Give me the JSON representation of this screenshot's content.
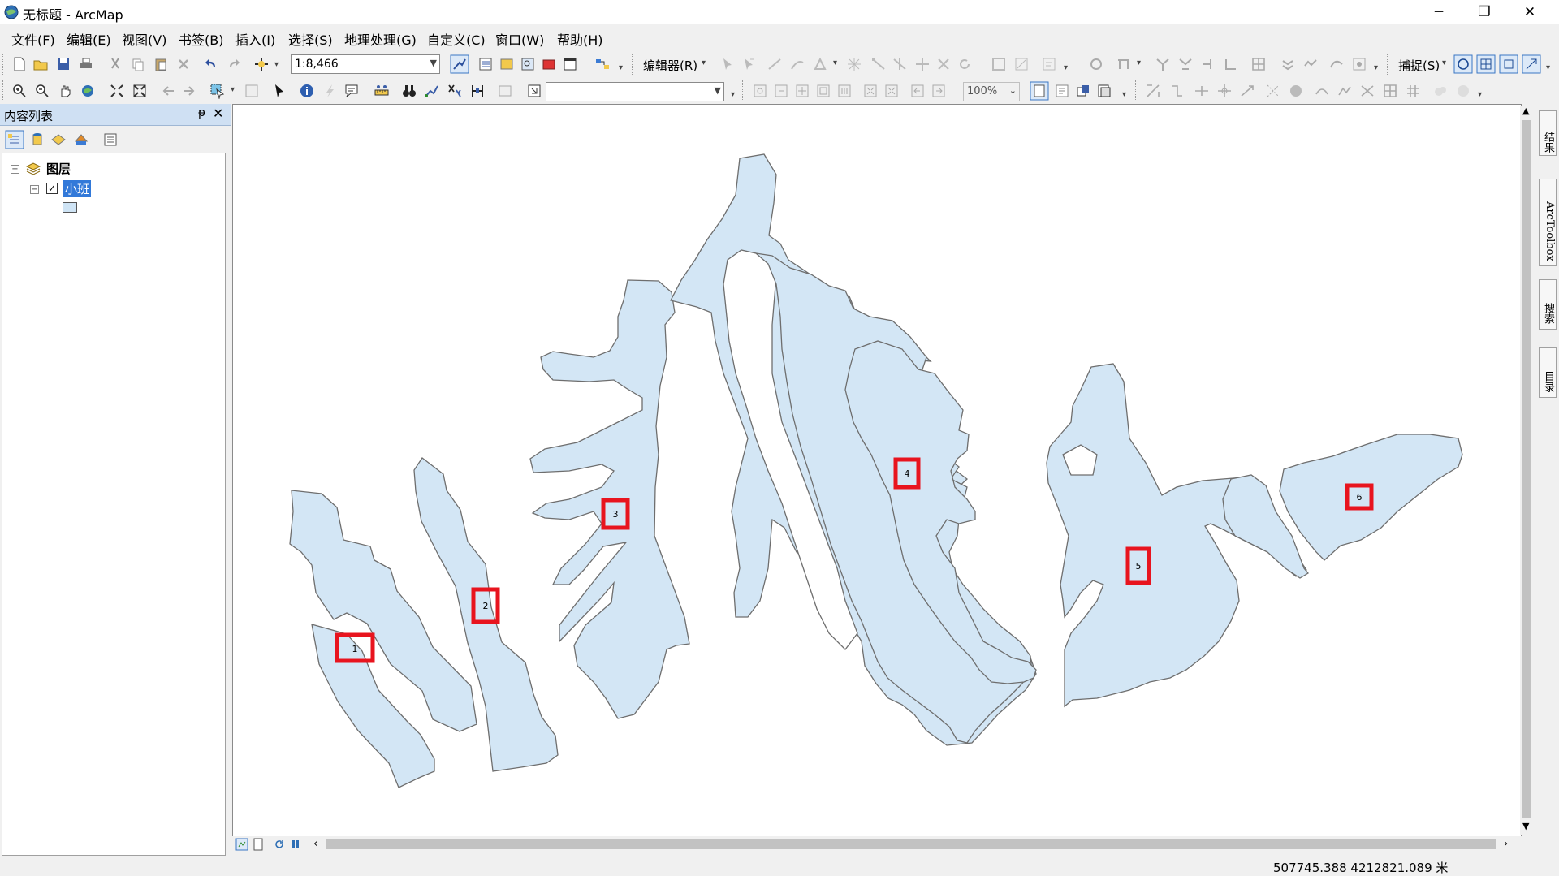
{
  "window": {
    "title": "无标题 - ArcMap",
    "minimize": "─",
    "restore": "❐",
    "close": "✕"
  },
  "menu": [
    "文件(F)",
    "编辑(E)",
    "视图(V)",
    "书签(B)",
    "插入(I)",
    "选择(S)",
    "地理处理(G)",
    "自定义(C)",
    "窗口(W)",
    "帮助(H)"
  ],
  "toolbar": {
    "scale_value": "1:8,466",
    "editor_label": "编辑器(R)",
    "snapping_label": "捕捉(S)",
    "zoom_percent": "100%",
    "layer_combo_value": ""
  },
  "toc": {
    "title": "内容列表",
    "pin": "ᵽ",
    "close": "✕",
    "group_label": "图层",
    "layer_label": "小班",
    "layer_checked": true
  },
  "map": {
    "fill_color": "#d3e6f5",
    "label_box_color": "#e8141e",
    "features": [
      {
        "id": "1",
        "label": "1"
      },
      {
        "id": "2",
        "label": "2"
      },
      {
        "id": "3",
        "label": "3"
      },
      {
        "id": "4",
        "label": "4"
      },
      {
        "id": "5",
        "label": "5"
      },
      {
        "id": "6",
        "label": "6"
      }
    ]
  },
  "right_dock": [
    "结果",
    "ArcToolbox",
    "搜索",
    "目录"
  ],
  "status": {
    "coordinates": "507745.388  4212821.089 米"
  }
}
